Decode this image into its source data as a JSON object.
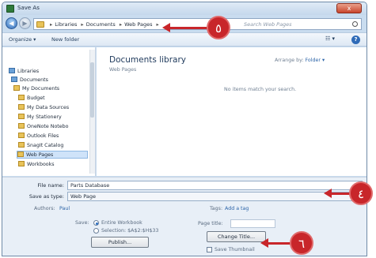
{
  "window": {
    "title": "Save As",
    "close_glyph": "x"
  },
  "nav": {
    "back_glyph": "◀",
    "forward_glyph": "▶",
    "breadcrumbs": [
      "Libraries",
      "Documents",
      "Web Pages"
    ],
    "search_placeholder": "Search Web Pages"
  },
  "toolbar": {
    "organize": "Organize ▾",
    "new_folder": "New folder",
    "view": "☷ ▾",
    "help": "?"
  },
  "tree": {
    "items": [
      {
        "label": "Libraries",
        "icon": "library-icon"
      },
      {
        "label": "Documents",
        "icon": "library-icon"
      },
      {
        "label": "My Documents",
        "icon": "folder-icon"
      },
      {
        "label": "Budget",
        "icon": "folder-icon"
      },
      {
        "label": "My Data Sources",
        "icon": "folder-icon"
      },
      {
        "label": "My Stationery",
        "icon": "folder-icon"
      },
      {
        "label": "OneNote Notebo",
        "icon": "folder-icon"
      },
      {
        "label": "Outlook Files",
        "icon": "folder-icon"
      },
      {
        "label": "SnagIt Catalog",
        "icon": "folder-icon"
      },
      {
        "label": "Web Pages",
        "icon": "folder-icon",
        "selected": true
      },
      {
        "label": "Workbooks",
        "icon": "folder-icon"
      }
    ]
  },
  "library": {
    "title": "Documents library",
    "subtitle": "Web Pages",
    "arrange_label": "Arrange by:",
    "arrange_value": "Folder ▾",
    "empty_message": "No items match your search."
  },
  "form": {
    "file_name_label": "File name:",
    "file_name_value": "Parts Database",
    "save_type_label": "Save as type:",
    "save_type_value": "Web Page",
    "authors_label": "Authors:",
    "authors_value": "Paul",
    "tags_label": "Tags:",
    "tags_value": "Add a tag",
    "save_label": "Save:",
    "save_option_entire": "Entire Workbook",
    "save_option_selection": "Selection: $A$2:$H$33",
    "page_title_label": "Page title:",
    "publish_button": "Publish...",
    "change_title_button": "Change Title...",
    "save_thumbnail": "Save Thumbnail"
  },
  "callouts": {
    "address": "٥",
    "save_type": "٤",
    "change_title": "٦"
  },
  "colors": {
    "callout": "#c8262a",
    "accent": "#2c64a8"
  }
}
